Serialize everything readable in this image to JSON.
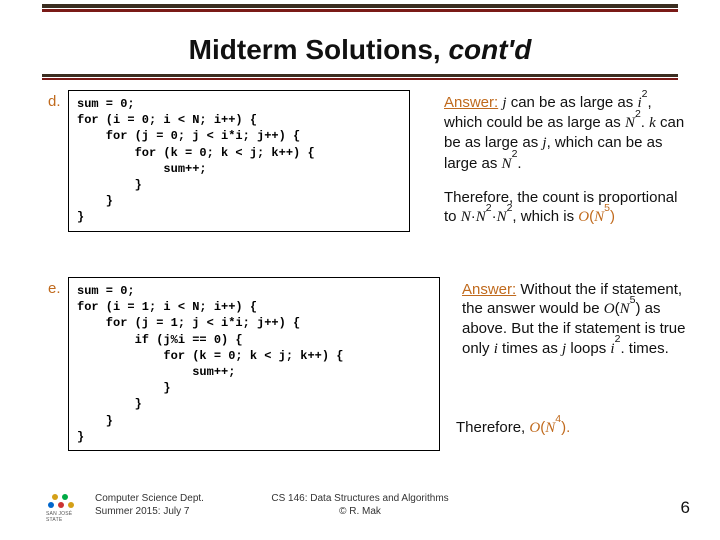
{
  "rules": {
    "top_dark": "#3a2d20",
    "top_red": "#7a1a17"
  },
  "title_plain": "Midterm Solutions, ",
  "title_italic": "cont'd",
  "labels": {
    "d": "d.",
    "e": "e."
  },
  "code_d": "sum = 0;\nfor (i = 0; i < N; i++) {\n    for (j = 0; j < i*i; j++) {\n        for (k = 0; k < j; k++) {\n            sum++;\n        }\n    }\n}",
  "code_e": "sum = 0;\nfor (i = 1; i < N; i++) {\n    for (j = 1; j < i*i; j++) {\n        if (j%i == 0) {\n            for (k = 0; k < j; k++) {\n                sum++;\n            }\n        }\n    }\n}",
  "ans_d1": {
    "lead": "Answer:",
    "t1": " ",
    "j": "j",
    "t2": " can be as large as ",
    "i2": "i",
    "t3": ", which could be as large as ",
    "N2a": "N",
    "t4": ". ",
    "k": "k",
    "t5": " can be as large as ",
    "j2": "j",
    "t6": ", which can be as large as ",
    "N2b": "N",
    "t7": "."
  },
  "ans_d2": {
    "t1": "Therefore, the count is proportional to ",
    "N": "N",
    "dot1": "·",
    "N2a": "N",
    "dot2": "·",
    "N2b": "N",
    "t2": ", which is ",
    "O": "O",
    "lp": "(",
    "N5": "N",
    "rp": ")"
  },
  "ans_e1": {
    "lead": "Answer:",
    "t1": " Without the if statement, the answer would be ",
    "O": "O",
    "lp": "(",
    "N5": "N",
    "rp": ")",
    "t2": " as above. But the if statement is true only ",
    "i": "i",
    "t3": " times as ",
    "j": "j",
    "t4": " loops ",
    "i2": "i",
    "t5": ". times."
  },
  "ans_e2": {
    "t1": "Therefore, ",
    "O": "O",
    "lp": "(",
    "N4": "N",
    "rp": ")."
  },
  "footer": {
    "left_l1": "Computer Science Dept.",
    "left_l2": "Summer 2015: July 7",
    "mid_l1": "CS 146: Data Structures and Algorithms",
    "mid_l2": "© R. Mak"
  },
  "page": "6",
  "logo_text": "SAN JOSÉ STATE"
}
